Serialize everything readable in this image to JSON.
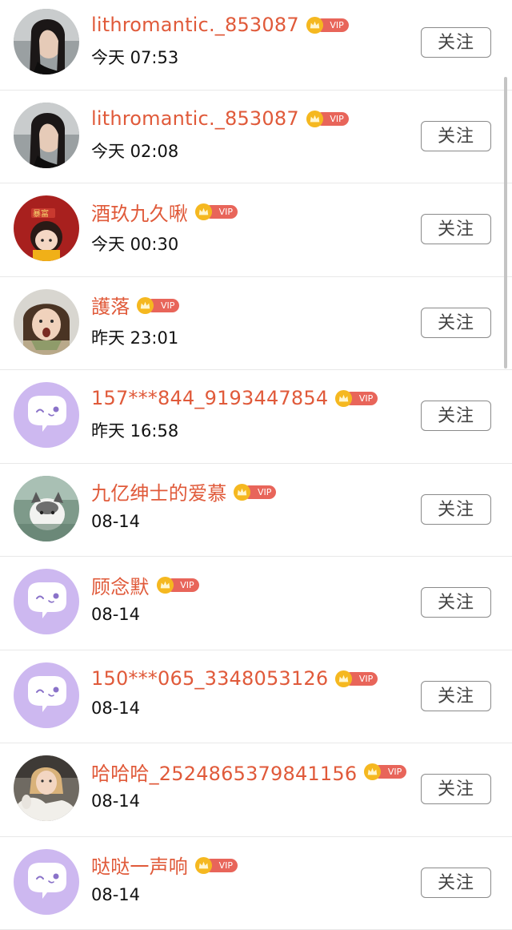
{
  "follow_label": "关注",
  "vip_label": "VIP",
  "rows": [
    {
      "name": "lithromantic._853087",
      "time": "今天 07:53",
      "avatar": "photo-woman"
    },
    {
      "name": "lithromantic._853087",
      "time": "今天 02:08",
      "avatar": "photo-woman"
    },
    {
      "name": "酒玖九久啾",
      "time": "今天 00:30",
      "avatar": "illustration-girl"
    },
    {
      "name": "護落",
      "time": "昨天 23:01",
      "avatar": "photo-child"
    },
    {
      "name": "157***844_9193447854",
      "time": "昨天 16:58",
      "avatar": "default-chat"
    },
    {
      "name": "九亿绅士的爱慕",
      "time": "08-14",
      "avatar": "photo-cat"
    },
    {
      "name": "顾念默",
      "time": "08-14",
      "avatar": "default-chat"
    },
    {
      "name": "150***065_3348053126",
      "time": "08-14",
      "avatar": "default-chat"
    },
    {
      "name": "哈哈哈_2524865379841156",
      "time": "08-14",
      "avatar": "photo-girl-horse"
    },
    {
      "name": "哒哒一声响",
      "time": "08-14",
      "avatar": "default-chat"
    }
  ],
  "colors": {
    "name": "#e05a3a",
    "vip_pill": "#e8655a",
    "crown": "#f5b820",
    "default_avatar_bg": "#cdb8f0",
    "divider": "#e8e8e8"
  }
}
